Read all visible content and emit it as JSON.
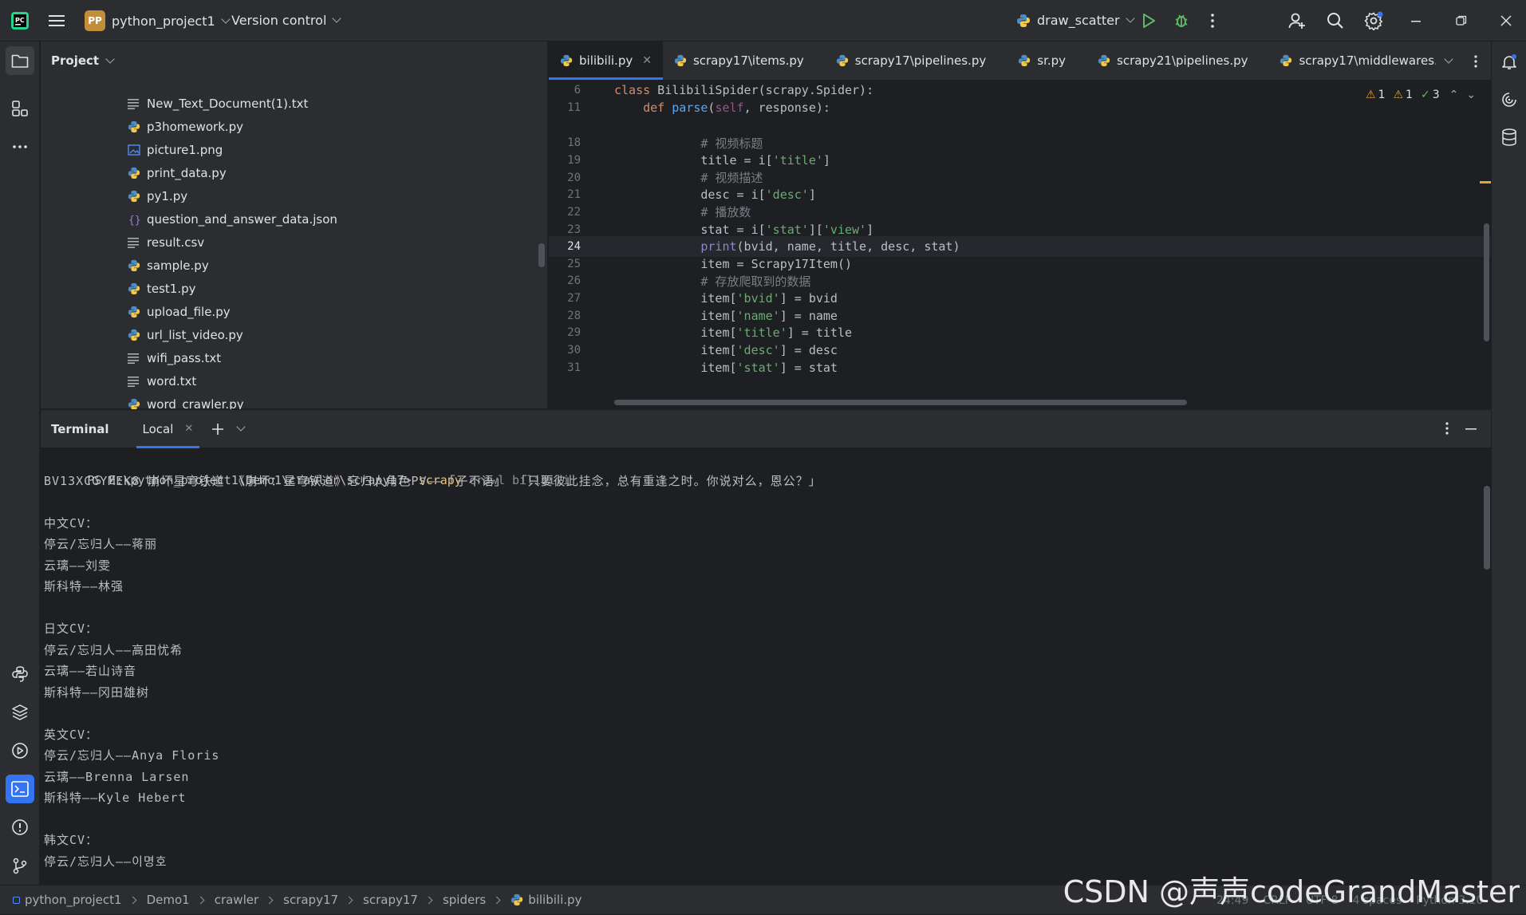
{
  "titlebar": {
    "project_badge": "PP",
    "project_name": "python_project1",
    "version_control": "Version control",
    "run_config": "draw_scatter"
  },
  "project_panel": {
    "title": "Project",
    "files": [
      {
        "name": "New_Text_Document(1).txt",
        "icon": "text-file-icon"
      },
      {
        "name": "p3homework.py",
        "icon": "python-file-icon"
      },
      {
        "name": "picture1.png",
        "icon": "image-file-icon"
      },
      {
        "name": "print_data.py",
        "icon": "python-file-icon"
      },
      {
        "name": "py1.py",
        "icon": "python-file-icon"
      },
      {
        "name": "question_and_answer_data.json",
        "icon": "json-file-icon"
      },
      {
        "name": "result.csv",
        "icon": "text-file-icon"
      },
      {
        "name": "sample.py",
        "icon": "python-file-icon"
      },
      {
        "name": "test1.py",
        "icon": "python-file-icon"
      },
      {
        "name": "upload_file.py",
        "icon": "python-file-icon"
      },
      {
        "name": "url_list_video.py",
        "icon": "python-file-icon"
      },
      {
        "name": "wifi_pass.txt",
        "icon": "text-file-icon"
      },
      {
        "name": "word.txt",
        "icon": "text-file-icon"
      },
      {
        "name": "word_crawler.py",
        "icon": "python-file-icon"
      }
    ]
  },
  "editor": {
    "tabs": [
      "bilibili.py",
      "scrapy17\\items.py",
      "scrapy17\\pipelines.py",
      "sr.py",
      "scrapy21\\pipelines.py",
      "scrapy17\\middlewares.py"
    ],
    "inspections": {
      "warnings": "1",
      "weak_warnings": "1",
      "typos": "3"
    },
    "sticky_lines": [
      {
        "ln": "6",
        "code": "class BilibiliSpider(scrapy.Spider):"
      },
      {
        "ln": "11",
        "code": "    def parse(self, response):"
      }
    ],
    "lines": [
      {
        "ln": "18",
        "code": "            # 视频标题"
      },
      {
        "ln": "19",
        "code": "            title = i['title']"
      },
      {
        "ln": "20",
        "code": "            # 视频描述"
      },
      {
        "ln": "21",
        "code": "            desc = i['desc']"
      },
      {
        "ln": "22",
        "code": "            # 播放数"
      },
      {
        "ln": "23",
        "code": "            stat = i['stat']['view']"
      },
      {
        "ln": "24",
        "code": "            print(bvid, name, title, desc, stat)"
      },
      {
        "ln": "25",
        "code": "            item = Scrapy17Item()"
      },
      {
        "ln": "26",
        "code": "            # 存放爬取到的数据"
      },
      {
        "ln": "27",
        "code": "            item['bvid'] = bvid"
      },
      {
        "ln": "28",
        "code": "            item['name'] = name"
      },
      {
        "ln": "29",
        "code": "            item['title'] = title"
      },
      {
        "ln": "30",
        "code": "            item['desc'] = desc"
      },
      {
        "ln": "31",
        "code": "            item['stat'] = stat"
      }
    ],
    "current_line": "24"
  },
  "terminal": {
    "title": "Terminal",
    "tab": "Local",
    "prompt": "PS E:\\python_project1\\Demo1\\crawler\\scrapy17>",
    "command": "scrapy",
    "command_args": " crawl bilibili",
    "output": [
      "BV13XCGYMEK8 崩坏星穹铁道 《崩坏：星穹铁道》忘归人角色PV——「子不语」 「只要彼此挂念，总有重逢之时。你说对么，恩公？」",
      "",
      "中文CV：",
      "停云/忘归人——蒋丽",
      "云璃——刘雯",
      "斯科特——林强",
      "",
      "日文CV：",
      "停云/忘归人——高田忧希",
      "云璃——若山诗音",
      "斯科特——冈田雄树",
      "",
      "英文CV：",
      "停云/忘归人——Anya Floris",
      "云璃——Brenna Larsen",
      "斯科特——Kyle Hebert",
      "",
      "韩文CV：",
      "停云/忘归人——이명호"
    ]
  },
  "statusbar": {
    "breadcrumbs": [
      "python_project1",
      "Demo1",
      "crawler",
      "scrapy17",
      "scrapy17",
      "spiders",
      "bilibili.py"
    ],
    "position": "24:49",
    "line_sep": "CRLF",
    "encoding": "UTF-8",
    "indent": "4 spaces",
    "interpreter": "Python 3.10"
  },
  "watermark": "CSDN @声声codeGrandMaster",
  "colors": {
    "accent": "#3574f0",
    "keyword": "#cf8e6d",
    "string": "#6aab73",
    "comment": "#7a7e85",
    "function": "#56a8f5"
  }
}
